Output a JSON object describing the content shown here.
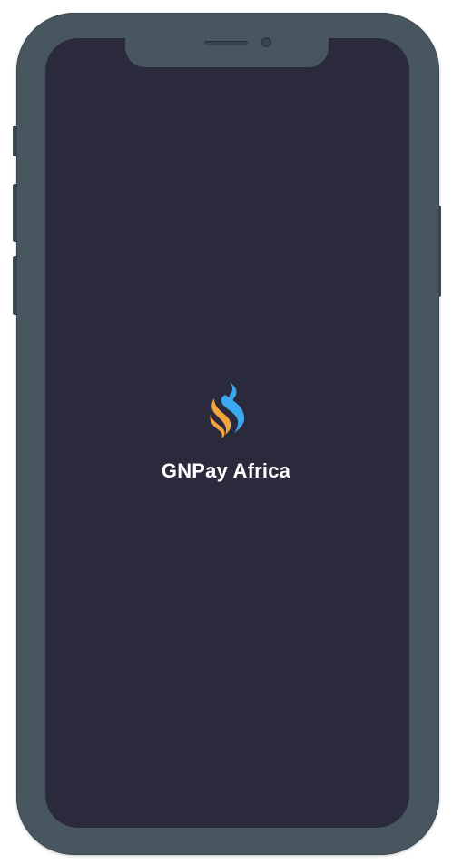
{
  "device": {
    "frame_color": "#485660",
    "screen_color": "#2a2a3c"
  },
  "splash": {
    "logo_icon": "gnpay-flame-logo-icon",
    "logo_colors": {
      "primary_blue": "#3ba9f0",
      "accent_orange": "#f6a53c"
    },
    "app_name": "GNPay Africa"
  }
}
